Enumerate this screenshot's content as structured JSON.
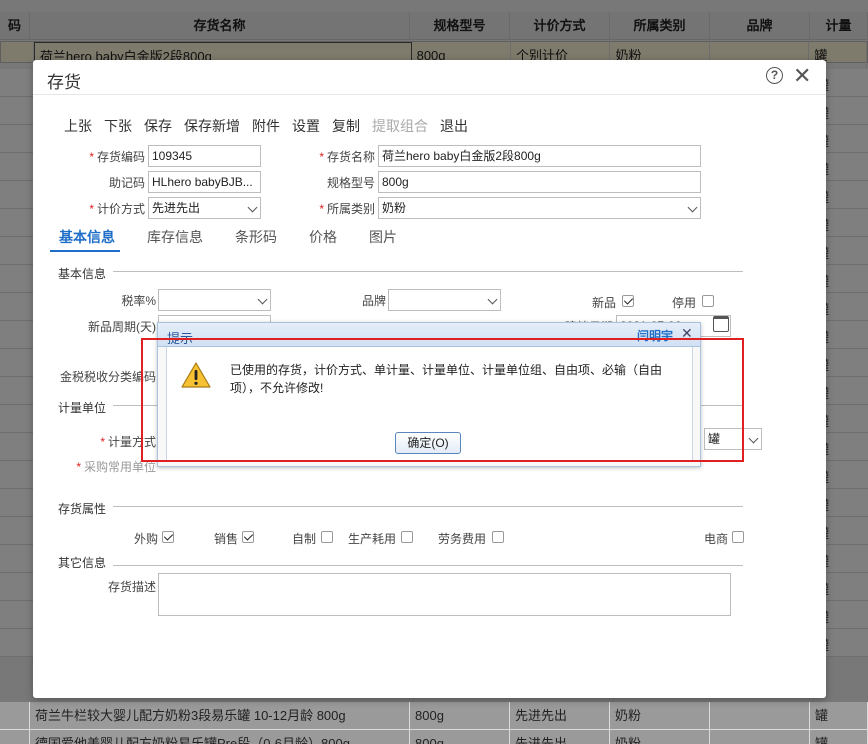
{
  "background_table": {
    "headers": [
      "码",
      "存货名称",
      "规格型号",
      "计价方式",
      "所属类别",
      "品牌",
      "计量"
    ],
    "selected_row": [
      "",
      "荷兰hero baby白金版2段800g",
      "800g",
      "个别计价",
      "奶粉",
      "",
      "罐"
    ],
    "bottom_rows": [
      [
        "",
        "荷兰牛栏较大婴儿配方奶粉3段易乐罐 10-12月龄 800g",
        "800g",
        "先进先出",
        "奶粉",
        "",
        "罐"
      ],
      [
        "",
        "德国爱他美婴儿配方奶粉易乐罐Pre段（0-6月龄）800g",
        "800g",
        "先进先出",
        "奶粉",
        "",
        "罐"
      ]
    ],
    "side_marks": [
      "罐",
      "罐",
      "罐",
      "罐",
      "罐",
      "罐",
      "罐",
      "罐",
      "罐",
      "罐",
      "罐",
      "罐",
      "罐",
      "罐",
      "罐",
      "罐",
      "罐",
      "罐",
      "罐",
      "罐",
      "罐"
    ]
  },
  "dialog": {
    "title": "存货",
    "help": "?",
    "close": "✕",
    "toolbar": [
      "上张",
      "下张",
      "保存",
      "保存新增",
      "附件",
      "设置",
      "复制",
      "提取组合",
      "退出"
    ],
    "fields": {
      "code_label": "存货编码",
      "code_value": "109345",
      "name_label": "存货名称",
      "name_value": "荷兰hero baby白金版2段800g",
      "mnemonic_label": "助记码",
      "mnemonic_value": "HLhero babyBJB...",
      "spec_label": "规格型号",
      "spec_value": "800g",
      "pricing_label": "计价方式",
      "pricing_value": "先进先出",
      "category_label": "所属类别",
      "category_value": "奶粉"
    },
    "tabs": [
      "基本信息",
      "库存信息",
      "条形码",
      "价格",
      "图片"
    ],
    "basic": {
      "section": "基本信息",
      "tax_label": "税率%",
      "brand_label": "品牌",
      "new_label": "新品",
      "disabled_label": "停用",
      "new_cycle_label": "新品周期(天)",
      "date_label_partial": "建档日期",
      "date_value_partial": "2021-07-06",
      "tax_code_label": "金税税收分类编码"
    },
    "unit": {
      "section": "计量单位",
      "method_label": "计量方式",
      "purchase_unit_label": "采购常用单位",
      "unit_value": "罐"
    },
    "attr": {
      "section": "存货属性",
      "purchase": "外购",
      "sale": "销售",
      "self_made": "自制",
      "production": "生产耗用",
      "labor": "劳务费用",
      "ecommerce": "电商"
    },
    "other": {
      "section": "其它信息",
      "desc_label": "存货描述"
    }
  },
  "prompt": {
    "title": "提示",
    "user": "闫明宇",
    "close": "✕",
    "message": "已使用的存货，计价方式、单计量、计量单位、计量单位组、自由项、必输（自由项），不允许修改!",
    "ok_label": "确定(O)"
  },
  "colors": {
    "accent": "#1f6fc9",
    "highlight_box": "#e02020",
    "selected_row": "#fdf7d8"
  }
}
